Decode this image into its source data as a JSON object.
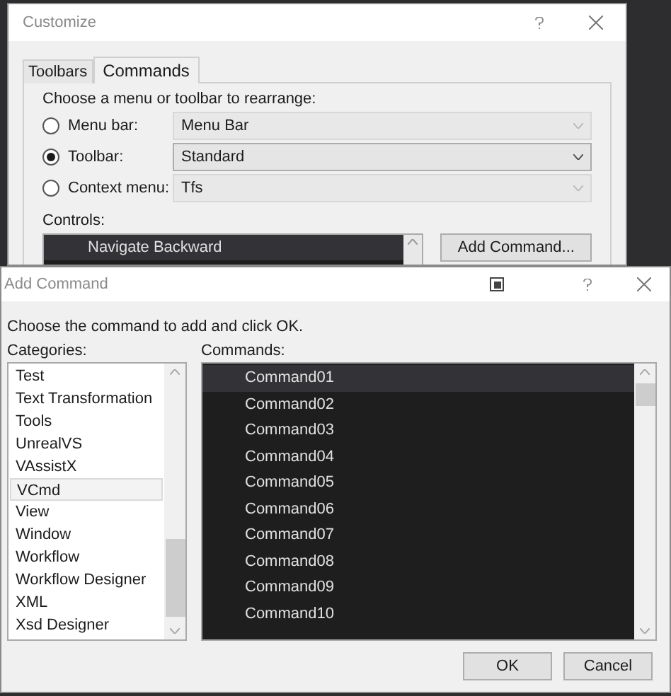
{
  "customize": {
    "title": "Customize",
    "tabs": [
      {
        "label": "Toolbars",
        "selected": false
      },
      {
        "label": "Commands",
        "selected": true
      }
    ],
    "prompt": "Choose a menu or toolbar to rearrange:",
    "options": [
      {
        "label": "Menu bar:",
        "value": "Menu Bar",
        "selected": false
      },
      {
        "label": "Toolbar:",
        "value": "Standard",
        "selected": true
      },
      {
        "label": "Context menu:",
        "value": "Tfs",
        "selected": false
      }
    ],
    "controls_label": "Controls:",
    "controls": [
      {
        "label": "Navigate Backward",
        "selected": true
      }
    ],
    "add_button": "Add Command..."
  },
  "add_command": {
    "title": "Add Command",
    "instruction": "Choose the command to add and click OK.",
    "categories_label": "Categories:",
    "commands_label": "Commands:",
    "categories": [
      {
        "label": "Test",
        "selected": false
      },
      {
        "label": "Text Transformation",
        "selected": false
      },
      {
        "label": "Tools",
        "selected": false
      },
      {
        "label": "UnrealVS",
        "selected": false
      },
      {
        "label": "VAssistX",
        "selected": false
      },
      {
        "label": "VCmd",
        "selected": true
      },
      {
        "label": "View",
        "selected": false
      },
      {
        "label": "Window",
        "selected": false
      },
      {
        "label": "Workflow",
        "selected": false
      },
      {
        "label": "Workflow Designer",
        "selected": false
      },
      {
        "label": "XML",
        "selected": false
      },
      {
        "label": "Xsd Designer",
        "selected": false
      }
    ],
    "commands": [
      {
        "label": "Command01",
        "selected": true
      },
      {
        "label": "Command02",
        "selected": false
      },
      {
        "label": "Command03",
        "selected": false
      },
      {
        "label": "Command04",
        "selected": false
      },
      {
        "label": "Command05",
        "selected": false
      },
      {
        "label": "Command06",
        "selected": false
      },
      {
        "label": "Command07",
        "selected": false
      },
      {
        "label": "Command08",
        "selected": false
      },
      {
        "label": "Command09",
        "selected": false
      },
      {
        "label": "Command10",
        "selected": false
      }
    ],
    "buttons": [
      "OK",
      "Cancel"
    ]
  }
}
